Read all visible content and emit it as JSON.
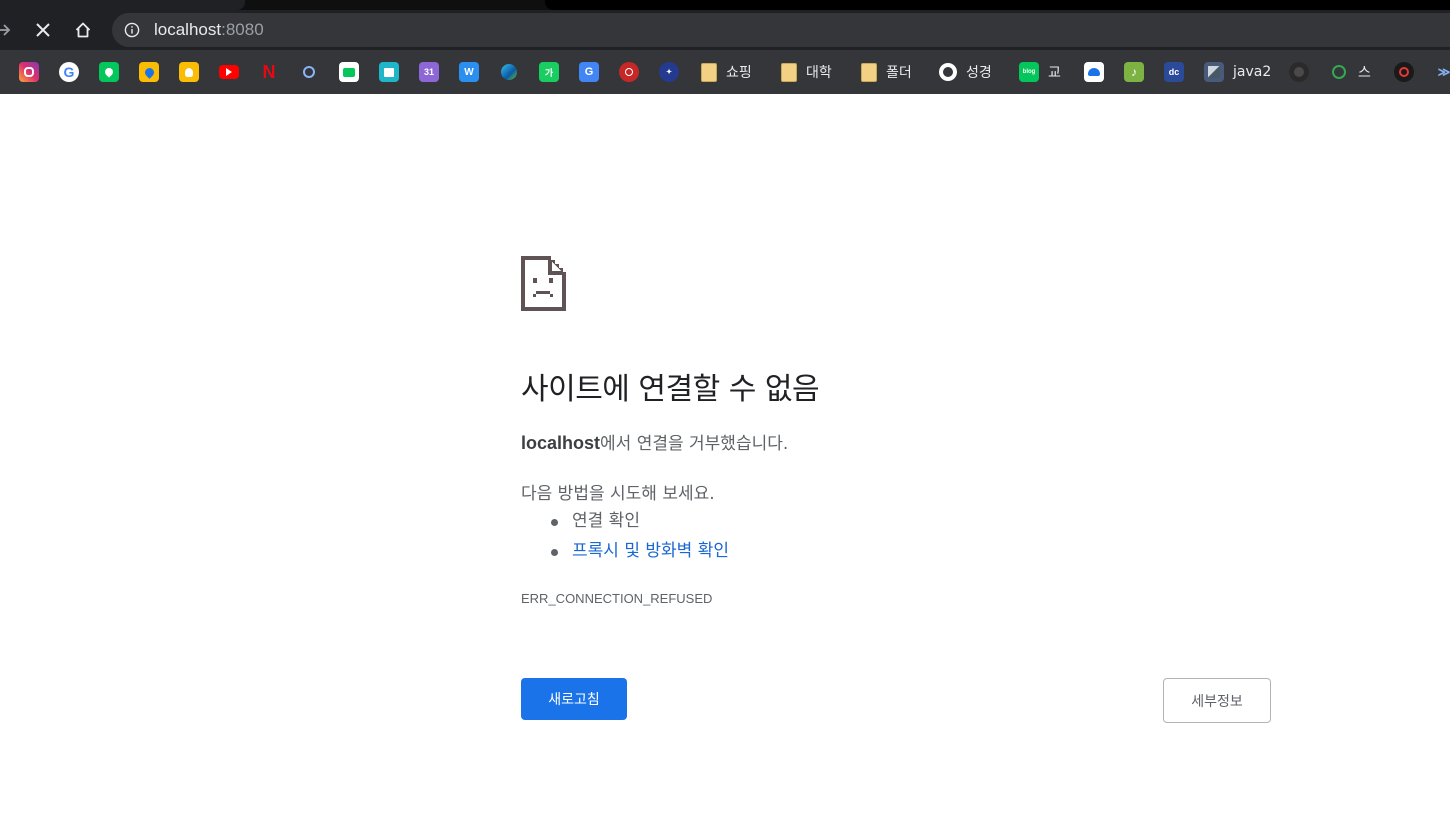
{
  "browser": {
    "address_host": "localhost",
    "address_port": ":8080",
    "bookmarks": {
      "shopping": "쇼핑",
      "university": "대학",
      "folder": "폴더",
      "bible": "성경",
      "blog_gyo": "교",
      "java2": "java2",
      "s": "스"
    }
  },
  "error_page": {
    "title": "사이트에 연결할 수 없음",
    "host": "localhost",
    "host_message": "에서 연결을 거부했습니다.",
    "try_label": "다음 방법을 시도해 보세요.",
    "suggestion_check_connection": "연결 확인",
    "suggestion_check_proxy": "프록시 및 방화벽 확인",
    "error_code": "ERR_CONNECTION_REFUSED",
    "reload_button": "새로고침",
    "details_button": "세부정보"
  },
  "colors": {
    "primary_button": "#1a73e8",
    "link": "#1967d2",
    "toolbar": "#202124",
    "bookmarks_bar": "#35363a"
  }
}
